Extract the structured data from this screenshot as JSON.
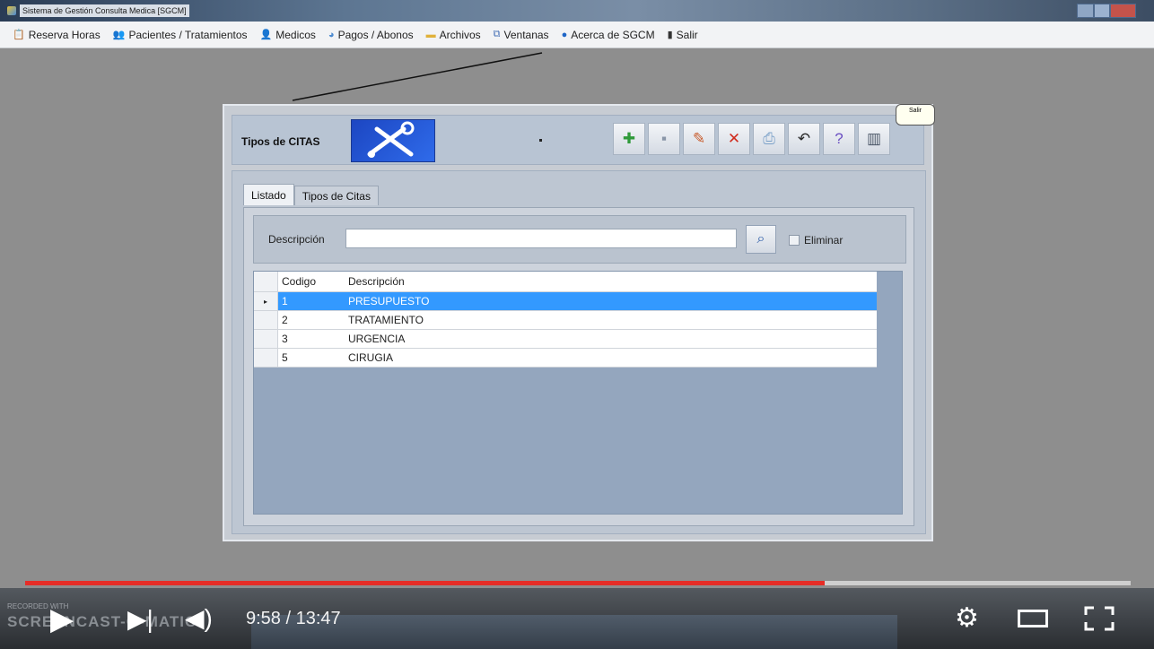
{
  "window": {
    "title": "Sistema de Gestión Consulta Medica [SGCM]"
  },
  "menu": {
    "items": [
      {
        "label": "Reserva Horas",
        "icon": "calendar-icon",
        "glyph": "📋",
        "color": "#6f8a3a"
      },
      {
        "label": "Pacientes / Tratamientos",
        "icon": "patients-icon",
        "glyph": "👥",
        "color": "#6a6a6a"
      },
      {
        "label": "Medicos",
        "icon": "doctor-icon",
        "glyph": "👤",
        "color": "#6a6a6a"
      },
      {
        "label": "Pagos / Abonos",
        "icon": "payments-icon",
        "glyph": "◕",
        "color": "#4c8ad0"
      },
      {
        "label": "Archivos",
        "icon": "folder-icon",
        "glyph": "▬",
        "color": "#e0b13a"
      },
      {
        "label": "Ventanas",
        "icon": "windows-icon",
        "glyph": "⧉",
        "color": "#4a74b8"
      },
      {
        "label": "Acerca de SGCM",
        "icon": "info-icon",
        "glyph": "●",
        "color": "#1f66c7"
      },
      {
        "label": "Salir",
        "icon": "exit-icon",
        "glyph": "▮",
        "color": "#333333"
      }
    ]
  },
  "form": {
    "title": "Tipos de CITAS",
    "toolbar": [
      {
        "name": "new-button",
        "icon": "new-document-icon",
        "glyph": "✚",
        "color": "#2f9a3a"
      },
      {
        "name": "save-button",
        "icon": "save-icon",
        "glyph": "▪",
        "color": "#8a96a8"
      },
      {
        "name": "edit-button",
        "icon": "edit-icon",
        "glyph": "✎",
        "color": "#c85a2a"
      },
      {
        "name": "delete-button",
        "icon": "delete-icon",
        "glyph": "✕",
        "color": "#d02c1e"
      },
      {
        "name": "print-button",
        "icon": "printer-icon",
        "glyph": "⎙",
        "color": "#7aa0c8"
      },
      {
        "name": "undo-button",
        "icon": "undo-icon",
        "glyph": "↶",
        "color": "#2a2a2a"
      },
      {
        "name": "help-button",
        "icon": "help-icon",
        "glyph": "?",
        "color": "#6b4fc2"
      },
      {
        "name": "exit-form-button",
        "icon": "door-exit-icon",
        "glyph": "▥",
        "color": "#4a5566"
      }
    ],
    "tooltip": "Salir",
    "tabs": [
      {
        "label": "Listado",
        "active": true
      },
      {
        "label": "Tipos de Citas",
        "active": false
      }
    ],
    "search": {
      "label": "Descripción",
      "value": "",
      "checkbox_label": "Eliminar",
      "checked": false
    },
    "grid": {
      "columns": [
        "Codigo",
        "Descripción"
      ],
      "rows": [
        {
          "code": "1",
          "description": "PRESUPUESTO",
          "selected": true
        },
        {
          "code": "2",
          "description": "TRATAMIENTO",
          "selected": false
        },
        {
          "code": "3",
          "description": "URGENCIA",
          "selected": false
        },
        {
          "code": "5",
          "description": "CIRUGIA",
          "selected": false
        }
      ]
    }
  },
  "player": {
    "current_time": "9:58",
    "duration": "13:47",
    "time_display": "9:58 / 13:47",
    "progress": 0.723,
    "progress_color": "#e52d27",
    "watermark": "SCREENCAST-O-MATIC",
    "watermark_small": "RECORDED WITH"
  }
}
